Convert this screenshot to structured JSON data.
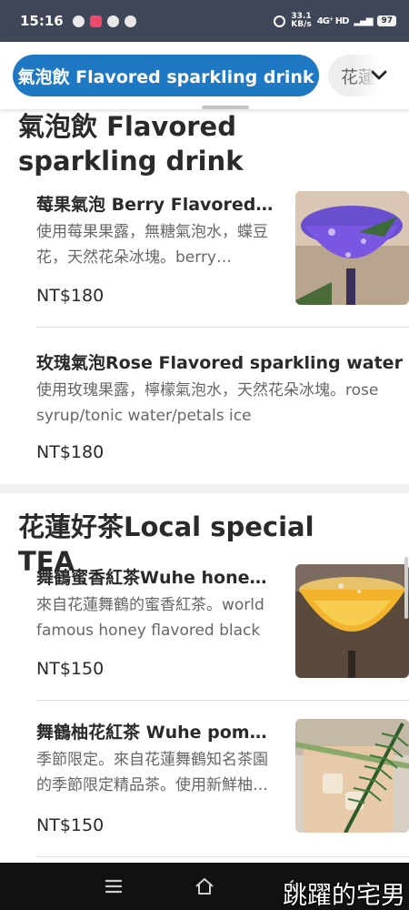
{
  "status_bar": {
    "time": "15:16",
    "net_speed_value": "33.1",
    "net_speed_unit": "KB/s",
    "network": "4G⁺ HD",
    "battery": "97"
  },
  "tabs": {
    "active_label": "氣泡飲 Flavored sparkling drink",
    "next_label": "花蓮好茶Local special TEA",
    "expand_icon": "chevron-down-icon",
    "accent_color": "#1f78c3"
  },
  "sections": [
    {
      "title": "氣泡飲 Flavored sparkling drink",
      "items": [
        {
          "name": "莓果氣泡 Berry Flavored sparkling water",
          "description": "使用莓果果露，無糖氣泡水，蝶豆花，天然花朵冰塊。berry…",
          "price": "NT$180"
        },
        {
          "name": "玫瑰氣泡Rose Flavored sparkling water",
          "description": "使用玫瑰果露，檸檬氣泡水，天然花朵冰塊。rose syrup/tonic water/petals ice",
          "price": "NT$180"
        }
      ]
    },
    {
      "title": "花蓮好茶Local special TEA",
      "items": [
        {
          "name": "舞鶴蜜香紅茶Wuhe honey flavored black tea",
          "description": "來自花蓮舞鶴的蜜香紅茶。world famous honey flavored black t…",
          "price": "NT$150"
        },
        {
          "name": "舞鶴柚花紅茶 Wuhe pomelo flower black tea",
          "description": "季節限定。來自花蓮舞鶴知名茶園的季節限定精品茶。使用新鮮柚…",
          "price": "NT$150"
        }
      ]
    }
  ],
  "watermark": "跳躍的宅男"
}
